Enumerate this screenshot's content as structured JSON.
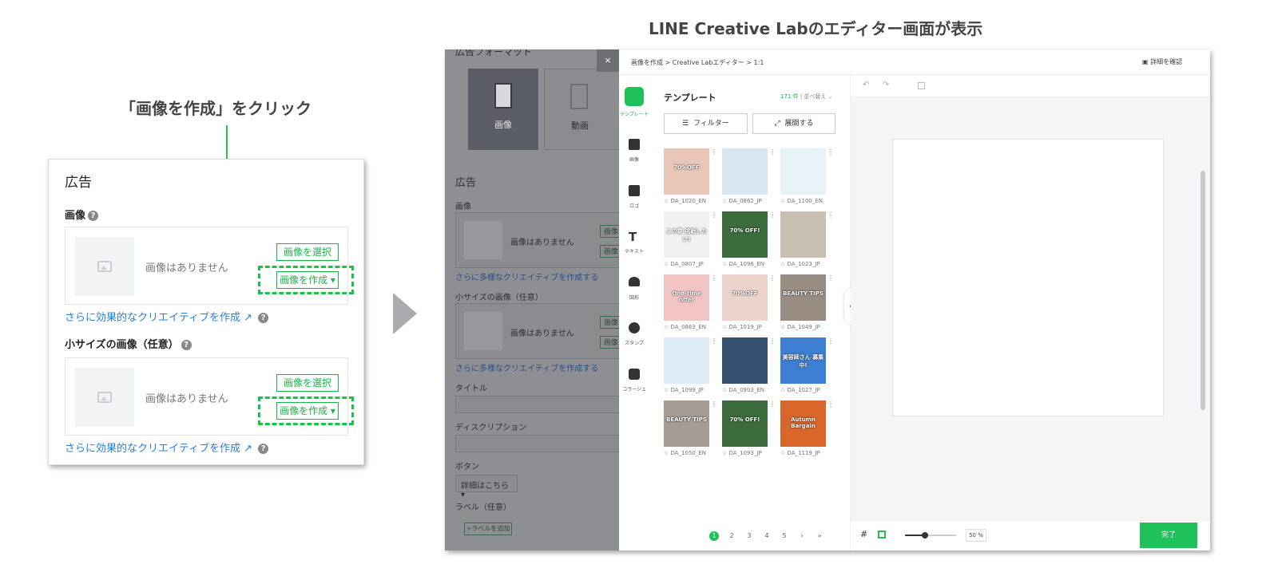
{
  "captions": {
    "left": "「画像を作成」をクリック",
    "right": "LINE Creative Labのエディター画面が表示"
  },
  "ad_panel": {
    "header": "広告",
    "image_label": "画像",
    "no_image_text": "画像はありません",
    "select_button": "画像を選択",
    "create_button": "画像を作成",
    "create_link": "さらに効果的なクリエイティブを作成",
    "small_image_label": "小サイズの画像（任意）"
  },
  "colors": {
    "accent_green": "#19b547",
    "link_blue": "#2b7fd8",
    "editor_done_green": "#1fc25a"
  },
  "background_form": {
    "format_title": "広告フォーマット",
    "format_image": "画像",
    "format_video": "動画",
    "section_title": "広告",
    "image_label": "画像",
    "no_image_text": "画像はありません",
    "more_link": "さらに多様なクリエイティブを作成する",
    "small_image_label": "小サイズの画像（任意）",
    "title_label": "タイトル",
    "description_label": "ディスクリプション",
    "button_label": "ボタン",
    "button_value": "詳細はこちら",
    "label_label": "ラベル（任意）",
    "add_label_button": "+ラベルを追加",
    "btn_short_1": "画像",
    "btn_short_2": "画像"
  },
  "editor": {
    "close": "×",
    "breadcrumb": "画像を作成 > Creative Labエディター > 1:1",
    "details": "詳細を確認",
    "nav": [
      {
        "label": "テンプレート",
        "icon": "template-icon"
      },
      {
        "label": "画像",
        "icon": "image-icon"
      },
      {
        "label": "ロゴ",
        "icon": "logo-icon"
      },
      {
        "label": "テキスト",
        "icon": "text-icon"
      },
      {
        "label": "図形",
        "icon": "shape-icon"
      },
      {
        "label": "スタンプ",
        "icon": "sticker-icon"
      },
      {
        "label": "コラージュ",
        "icon": "collage-icon"
      }
    ],
    "panel_title": "テンプレート",
    "count": "171 件",
    "sort": "並べ替え",
    "filter_button": "フィルター",
    "expand_button": "展開する",
    "templates": [
      {
        "name": "DA_1020_EN",
        "color": "#e9c6b8",
        "text": "70%OFF"
      },
      {
        "name": "DA_0862_JP",
        "color": "#d9e6f2",
        "text": ""
      },
      {
        "name": "DA_1100_EN",
        "color": "#e8f3f8",
        "text": ""
      },
      {
        "name": "DA_0807_JP",
        "color": "#f1f1f1",
        "text": "この春 挑戦したい!"
      },
      {
        "name": "DA_1096_EN",
        "color": "#3c6b3e",
        "text": "70% OFF!"
      },
      {
        "name": "DA_1023_JP",
        "color": "#c9bfb3",
        "text": ""
      },
      {
        "name": "DA_0863_EN",
        "color": "#f2c4c4",
        "text": "One-time offer"
      },
      {
        "name": "DA_1019_JP",
        "color": "#ecd3cb",
        "text": "70%OFF"
      },
      {
        "name": "DA_1049_JP",
        "color": "#9a8d84",
        "text": "BEAUTY TIPS"
      },
      {
        "name": "DA_1099_JP",
        "color": "#dcebf5",
        "text": ""
      },
      {
        "name": "DA_0903_EN",
        "color": "#35506e",
        "text": ""
      },
      {
        "name": "DA_1027_JP",
        "color": "#3f7fd3",
        "text": "美容師さん 募集中!"
      },
      {
        "name": "DA_1050_EN",
        "color": "#a79c94",
        "text": "BEAUTY TIPS"
      },
      {
        "name": "DA_1093_JP",
        "color": "#3c6b3e",
        "text": "70% OFF!"
      },
      {
        "name": "DA_1119_JP",
        "color": "#d9662b",
        "text": "Autumn Bargain"
      }
    ],
    "pages": [
      "1",
      "2",
      "3",
      "4",
      "5",
      "›",
      "»"
    ],
    "zoom": "50 %",
    "done_button": "完了"
  }
}
